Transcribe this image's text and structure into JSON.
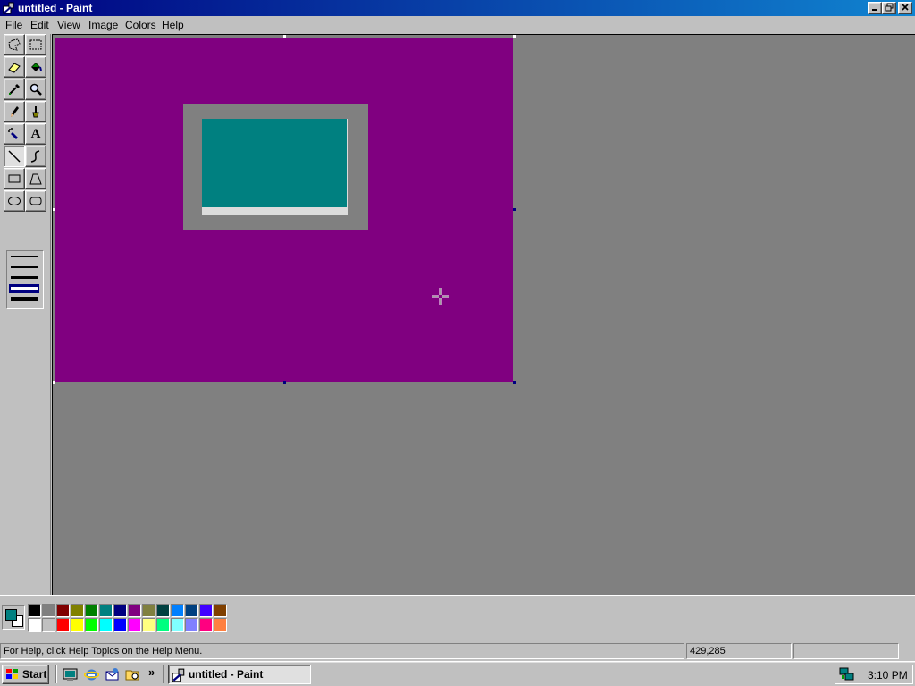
{
  "window": {
    "title": "untitled - Paint"
  },
  "menu": [
    {
      "label": "File"
    },
    {
      "label": "Edit"
    },
    {
      "label": "View"
    },
    {
      "label": "Image"
    },
    {
      "label": "Colors"
    },
    {
      "label": "Help"
    }
  ],
  "tools": [
    "free-form-select-icon",
    "select-icon",
    "eraser-icon",
    "fill-icon",
    "pick-color-icon",
    "magnifier-icon",
    "pencil-icon",
    "brush-icon",
    "airbrush-icon",
    "text-icon",
    "line-icon",
    "curve-icon",
    "rectangle-icon",
    "polygon-icon",
    "ellipse-icon",
    "rounded-rectangle-icon"
  ],
  "text_tool_glyph": "A",
  "colors": {
    "canvas": "#800080",
    "foreground": "#008080",
    "background": "#ffffff",
    "palette_top": [
      "#000000",
      "#808080",
      "#800000",
      "#808000",
      "#008000",
      "#008080",
      "#000080",
      "#800080",
      "#808040",
      "#004040",
      "#0080ff",
      "#004080",
      "#4000ff",
      "#804000"
    ],
    "palette_bottom": [
      "#ffffff",
      "#c0c0c0",
      "#ff0000",
      "#ffff00",
      "#00ff00",
      "#00ffff",
      "#0000ff",
      "#ff00ff",
      "#ffff80",
      "#00ff80",
      "#80ffff",
      "#8080ff",
      "#ff0080",
      "#ff8040"
    ]
  },
  "status": {
    "help_text": "For Help, click Help Topics on the Help Menu.",
    "coordinates": "429,285",
    "size": ""
  },
  "taskbar": {
    "start_label": "Start",
    "task_label": "untitled - Paint",
    "clock": "3:10 PM",
    "chevron": "»"
  }
}
